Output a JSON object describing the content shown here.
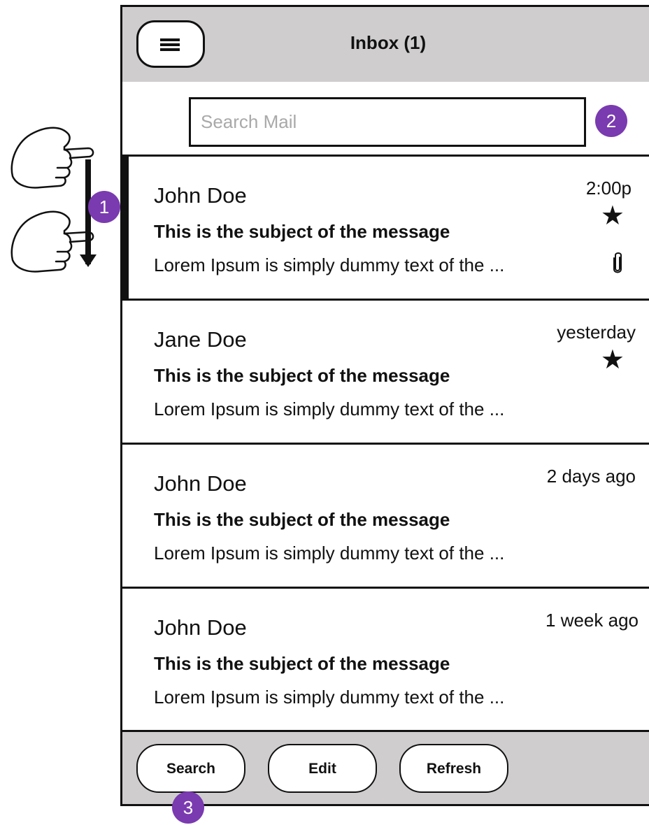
{
  "header": {
    "title": "Inbox (1)",
    "menu_icon": "hamburger-menu-icon"
  },
  "search": {
    "placeholder": "Search Mail",
    "value": ""
  },
  "messages": [
    {
      "sender": "John Doe",
      "time": "2:00p",
      "subject": "This is the subject of the message",
      "preview": "Lorem Ipsum is simply dummy text of the ...",
      "starred": true,
      "attachment": true,
      "selected": true
    },
    {
      "sender": "Jane Doe",
      "time": "yesterday",
      "subject": "This is the subject of the message",
      "preview": "Lorem Ipsum is simply dummy text of the ...",
      "starred": true,
      "attachment": false,
      "selected": false
    },
    {
      "sender": "John Doe",
      "time": "2 days ago",
      "subject": "This is the subject of the message",
      "preview": "Lorem Ipsum is simply dummy text of the ...",
      "starred": false,
      "attachment": false,
      "selected": false
    },
    {
      "sender": "John Doe",
      "time": "1 week ago",
      "subject": "This is the subject of the message",
      "preview": "Lorem Ipsum is simply dummy text of the ...",
      "starred": false,
      "attachment": false,
      "selected": false
    }
  ],
  "toolbar": {
    "search_label": "Search",
    "edit_label": "Edit",
    "refresh_label": "Refresh"
  },
  "annotations": {
    "one": "1",
    "two": "2",
    "three": "3"
  },
  "colors": {
    "header_bg": "#cfcdcd",
    "badge": "#7a3ab0"
  }
}
